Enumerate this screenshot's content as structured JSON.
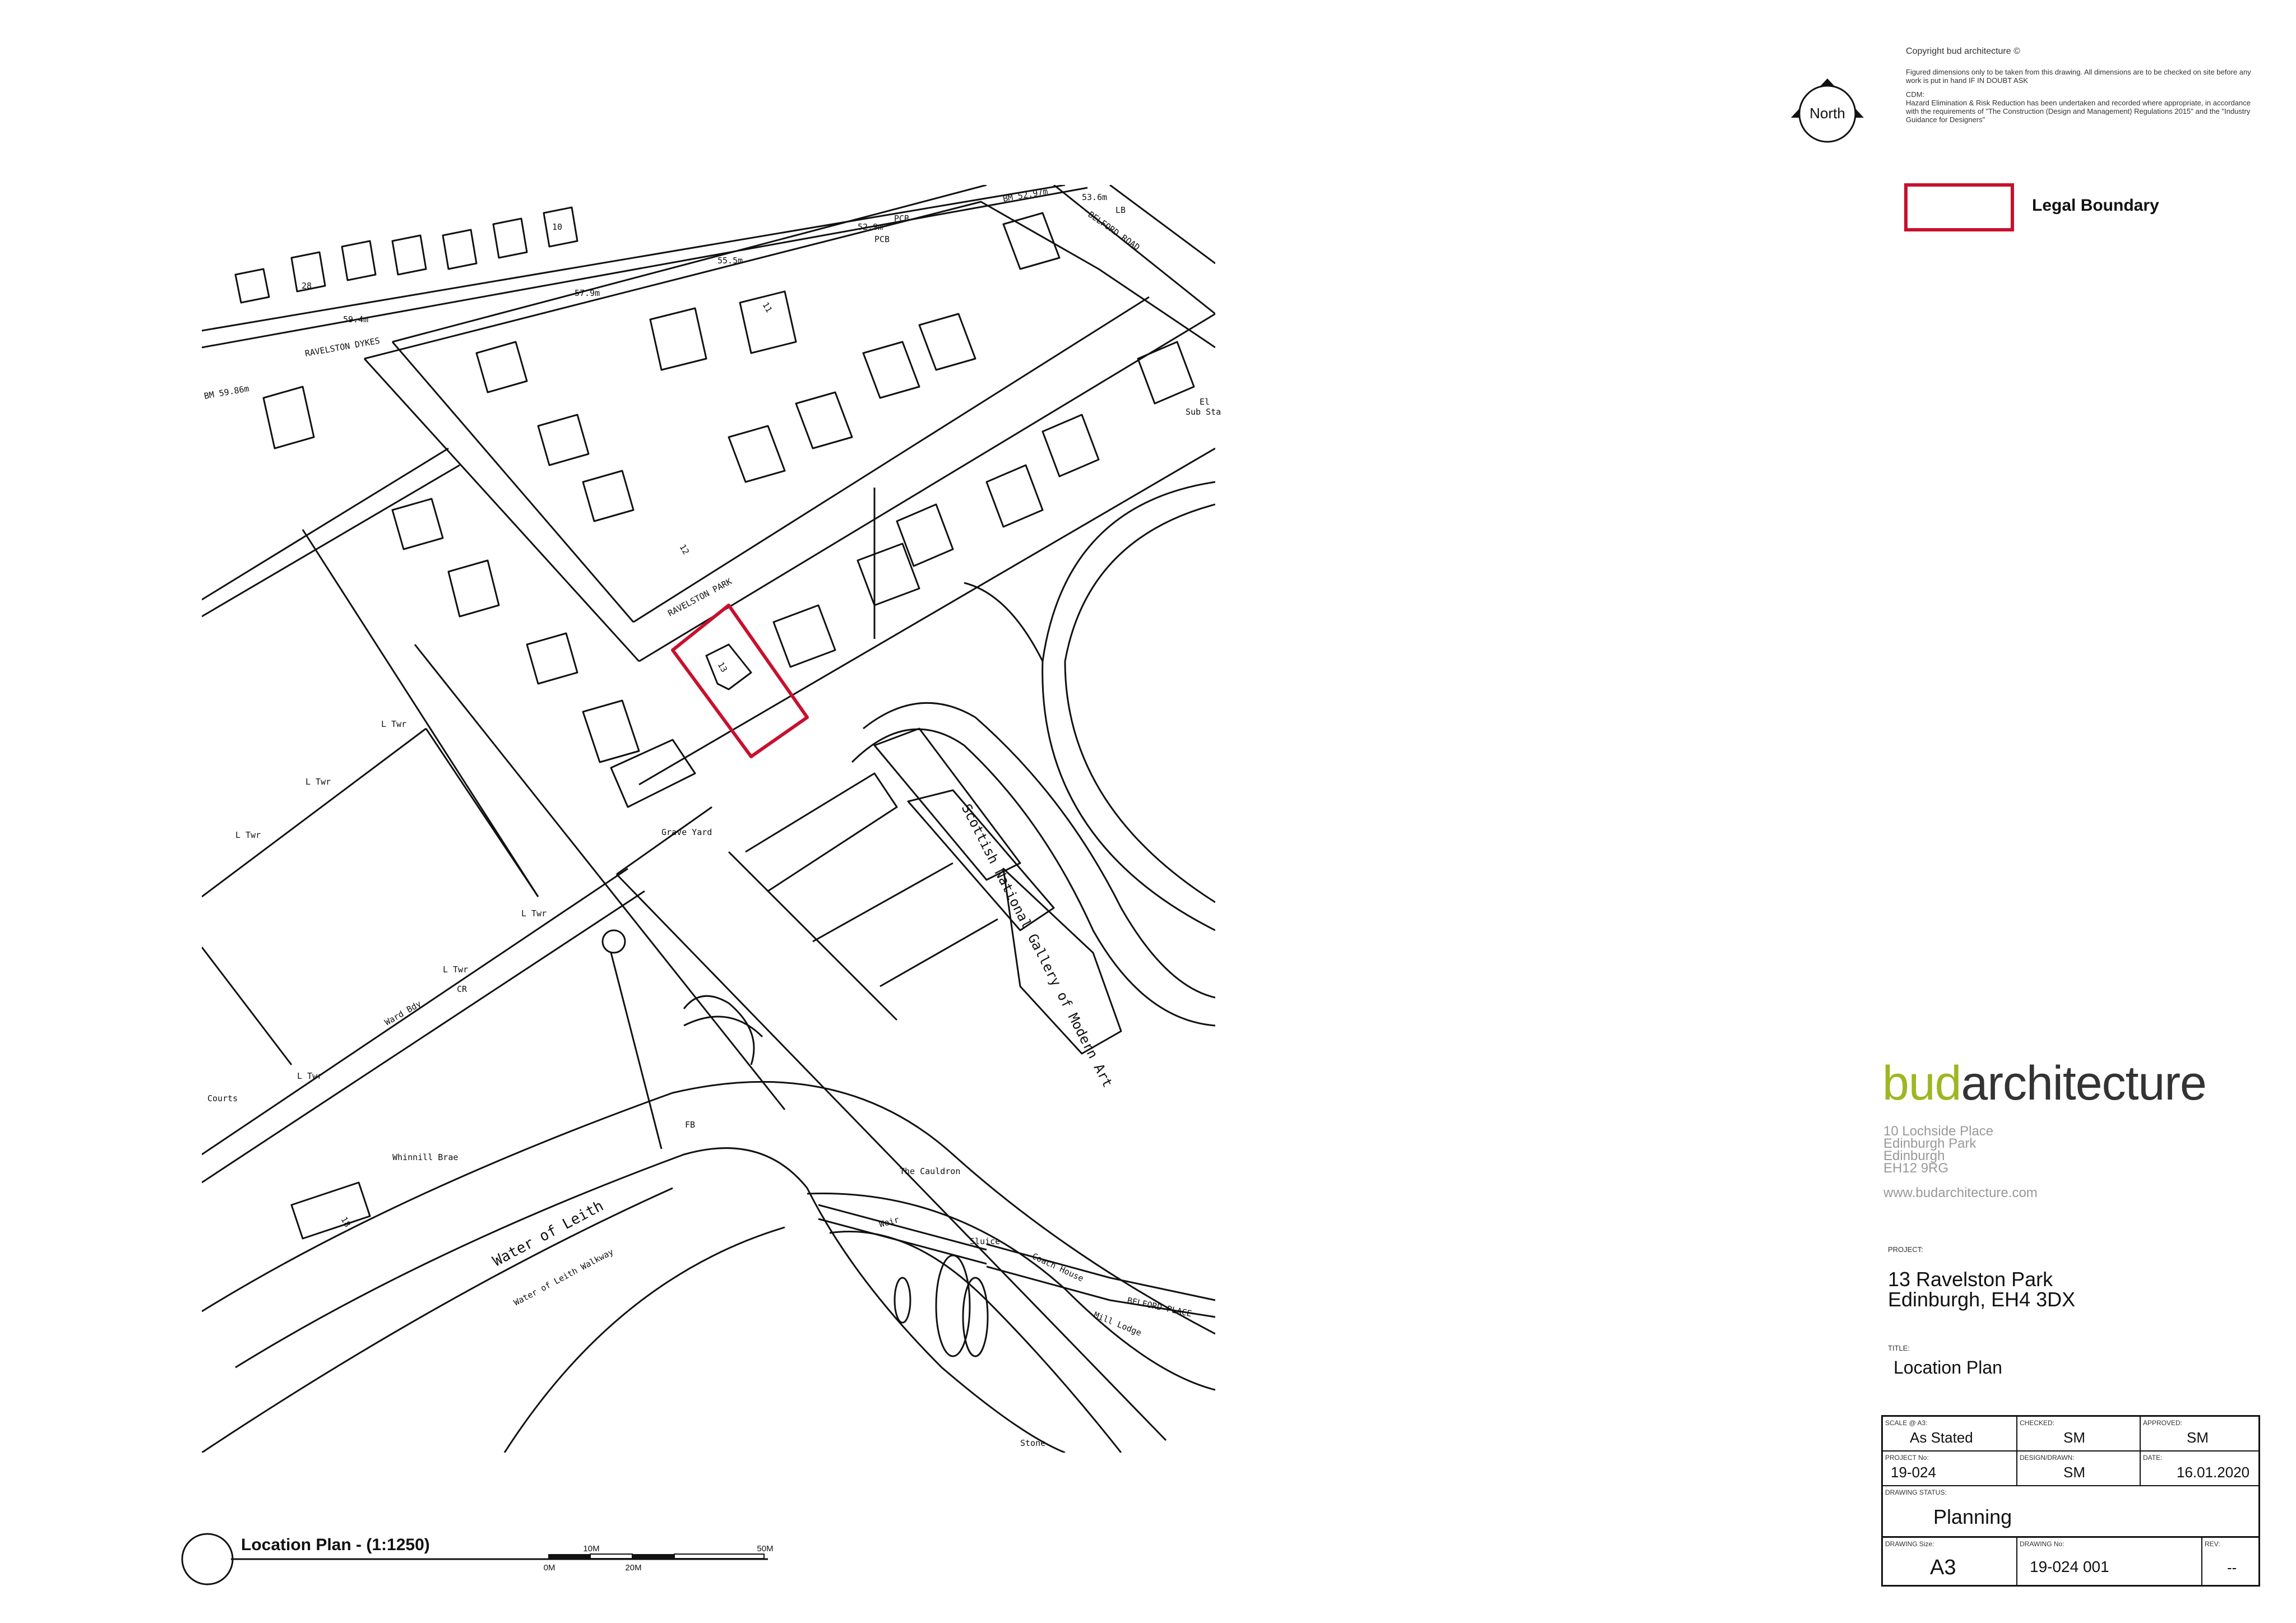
{
  "colors": {
    "accent": "#9fb623",
    "legal_boundary": "#c8102e",
    "line": "#111111"
  },
  "north": {
    "label": "North"
  },
  "notes": {
    "copyright": "Copyright bud architecture ©",
    "dimensions": "Figured dimensions only to be taken from this drawing. All dimensions are to be checked on site before any work is put in hand IF IN DOUBT ASK",
    "cdm_heading": "CDM:",
    "cdm_body": "Hazard Elimination & Risk Reduction has been undertaken and recorded where appropriate, in accordance with the requirements of \"The Construction (Design and Management) Regulations 2015\" and the \"Industry Guidance for Designers\""
  },
  "legend": {
    "label": "Legal Boundary"
  },
  "map_labels": {
    "ravelston_dykes": "RAVELSTON DYKES",
    "ravelston_park": "RAVELSTON PARK",
    "belford_road": "BELFORD ROAD",
    "belford_place": "BELFORD PLACE",
    "gallery": "Scottish National Gallery of Modern Art",
    "water_of_leith": "Water of Leith",
    "walkway": "Water of Leith Walkway",
    "whinnill_brae": "Whinnill Brae",
    "the_cauldron": "The Cauldron",
    "coach_house": "Coach House",
    "mill_lodge": "Mill Lodge",
    "grave_yard": "Grave Yard",
    "courts": "Courts",
    "l_twr": "L Twr",
    "ward_bdy": "Ward Bdy",
    "weir": "Weir",
    "sluice": "Sluice",
    "stone": "Stone",
    "bm1": "BM 52.97m",
    "bm2": "BM 59.86m",
    "h1": "53.6m",
    "h2": "52.9m",
    "h3": "55.5m",
    "h4": "57.9m",
    "h5": "59.4m",
    "pcb": "PCB",
    "fb": "FB",
    "sub_sta": "Sub Sta",
    "el": "El",
    "lb": "LB",
    "cr": "CR",
    "n13": "13",
    "n18": "18",
    "n12": "12",
    "n11": "11",
    "n28": "28",
    "n10": "10"
  },
  "plan_title": {
    "label": "Location Plan - (1:1250)"
  },
  "scale_bar": {
    "t10": "10M",
    "t50": "50M",
    "t0": "0M",
    "t20": "20M"
  },
  "company": {
    "logo_bud": "bud",
    "logo_arch": "architecture",
    "address1": "10  Lochside Place",
    "address2": "Edinburgh Park",
    "address3": "Edinburgh",
    "address4": "EH12 9RG",
    "web": "www.budarchitecture.com"
  },
  "project": {
    "label": "PROJECT:",
    "line1": "13 Ravelston Park",
    "line2": "Edinburgh, EH4 3DX"
  },
  "title": {
    "label": "TITLE:",
    "value": "Location Plan"
  },
  "title_block": {
    "scale_label": "SCALE @ A3:",
    "scale_value": "As Stated",
    "checked_label": "CHECKED:",
    "checked_value": "SM",
    "approved_label": "APPROVED:",
    "approved_value": "SM",
    "project_no_label": "PROJECT No:",
    "project_no_value": "19-024",
    "design_label": "DESIGN/DRAWN:",
    "design_value": "SM",
    "date_label": "DATE:",
    "date_value": "16.01.2020",
    "status_label": "DRAWING STATUS:",
    "status_value": "Planning",
    "size_label": "DRAWING Size:",
    "size_value": "A3",
    "drawing_no_label": "DRAWING No:",
    "drawing_no_value": "19-024 001",
    "rev_label": "REV:",
    "rev_value": "--"
  }
}
